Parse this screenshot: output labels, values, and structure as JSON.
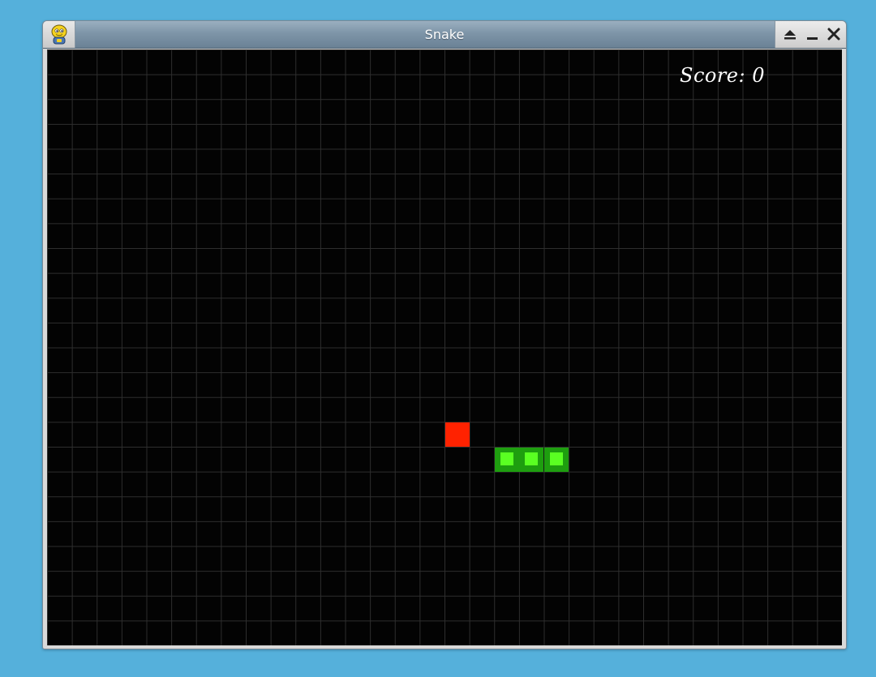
{
  "window": {
    "title": "Snake",
    "app_icon": "python-icon",
    "buttons": [
      {
        "name": "shade-button",
        "icon": "eject-icon"
      },
      {
        "name": "minimize-button",
        "icon": "minimize-icon"
      },
      {
        "name": "close-button",
        "icon": "close-icon"
      }
    ]
  },
  "game": {
    "score_label": "Score: 0",
    "grid": {
      "cols": 32,
      "rows": 24
    },
    "food": {
      "col": 16,
      "row": 15
    },
    "snake": [
      {
        "col": 18,
        "row": 16
      },
      {
        "col": 19,
        "row": 16
      },
      {
        "col": 20,
        "row": 16
      }
    ]
  },
  "colors": {
    "background": "#55b0db",
    "board": "#030303",
    "grid_line": "#2e2e2e",
    "food": "#ff2200",
    "snake_body": "#1e9e0f",
    "snake_inner": "#5aff22",
    "score_text": "#ffffff"
  }
}
